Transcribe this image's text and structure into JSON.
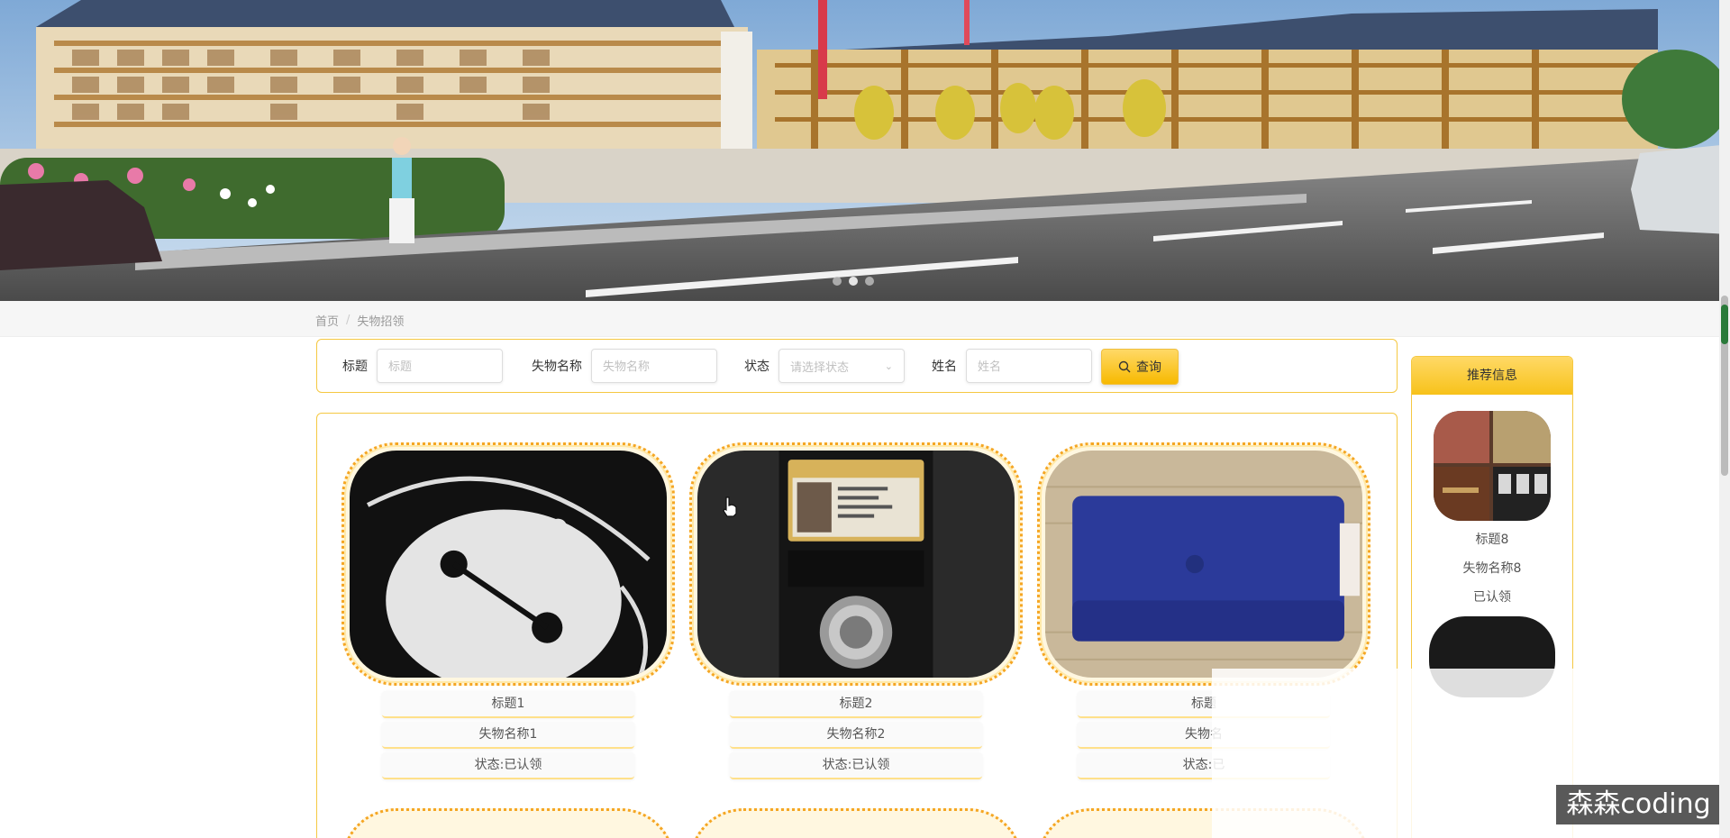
{
  "banner": {
    "slides": 3,
    "active_slide": 2
  },
  "breadcrumb": {
    "home": "首页",
    "current": "失物招领"
  },
  "search": {
    "title_label": "标题",
    "title_placeholder": "标题",
    "name_label": "失物名称",
    "name_placeholder": "失物名称",
    "status_label": "状态",
    "status_placeholder": "请选择状态",
    "person_label": "姓名",
    "person_placeholder": "姓名",
    "query_label": "查询"
  },
  "items": [
    {
      "title": "标题1",
      "name": "失物名称1",
      "status": "状态:已认领",
      "image": "baymax-coin-purse"
    },
    {
      "title": "标题2",
      "name": "失物名称2",
      "status": "状态:已认领",
      "image": "id-card-wallet"
    },
    {
      "title": "标题",
      "name": "失物名",
      "status": "状态:已",
      "image": "blue-wallet"
    }
  ],
  "sidebar": {
    "heading": "推荐信息",
    "item": {
      "title": "标题8",
      "name": "失物名称8",
      "status": "已认领",
      "image": "wallets-and-phones"
    }
  },
  "watermark": "森森coding",
  "colors": {
    "accent": "#f5c842",
    "button": "#f7b900"
  }
}
